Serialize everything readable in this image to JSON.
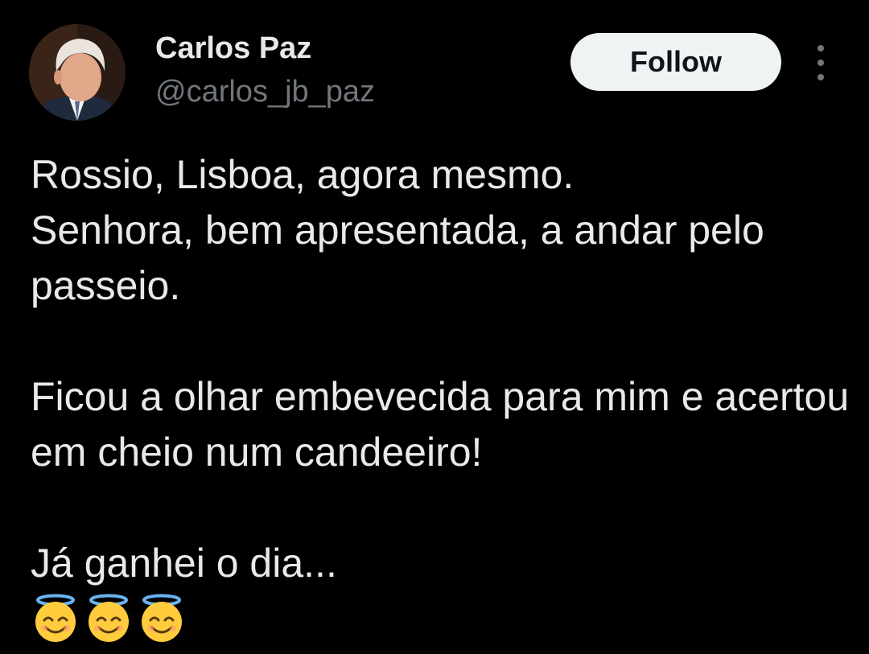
{
  "author": {
    "display_name": "Carlos Paz",
    "handle": "@carlos_jb_paz",
    "avatar_icon": "avatar-photo"
  },
  "actions": {
    "follow_label": "Follow",
    "more_icon": "more-vertical-icon"
  },
  "tweet": {
    "paragraphs": [
      "Rossio, Lisboa, agora mesmo.\nSenhora, bem apresentada, a andar pelo passeio.",
      "Ficou a olhar embevecida para mim e acertou em cheio num candeeiro!",
      "Já ganhei o dia..."
    ],
    "emojis": [
      "😇",
      "😇",
      "😇"
    ]
  },
  "colors": {
    "background": "#000000",
    "primary_text": "#e7e9ea",
    "secondary_text": "#71767b",
    "follow_bg": "#eff3f4",
    "follow_text": "#0f1419"
  }
}
